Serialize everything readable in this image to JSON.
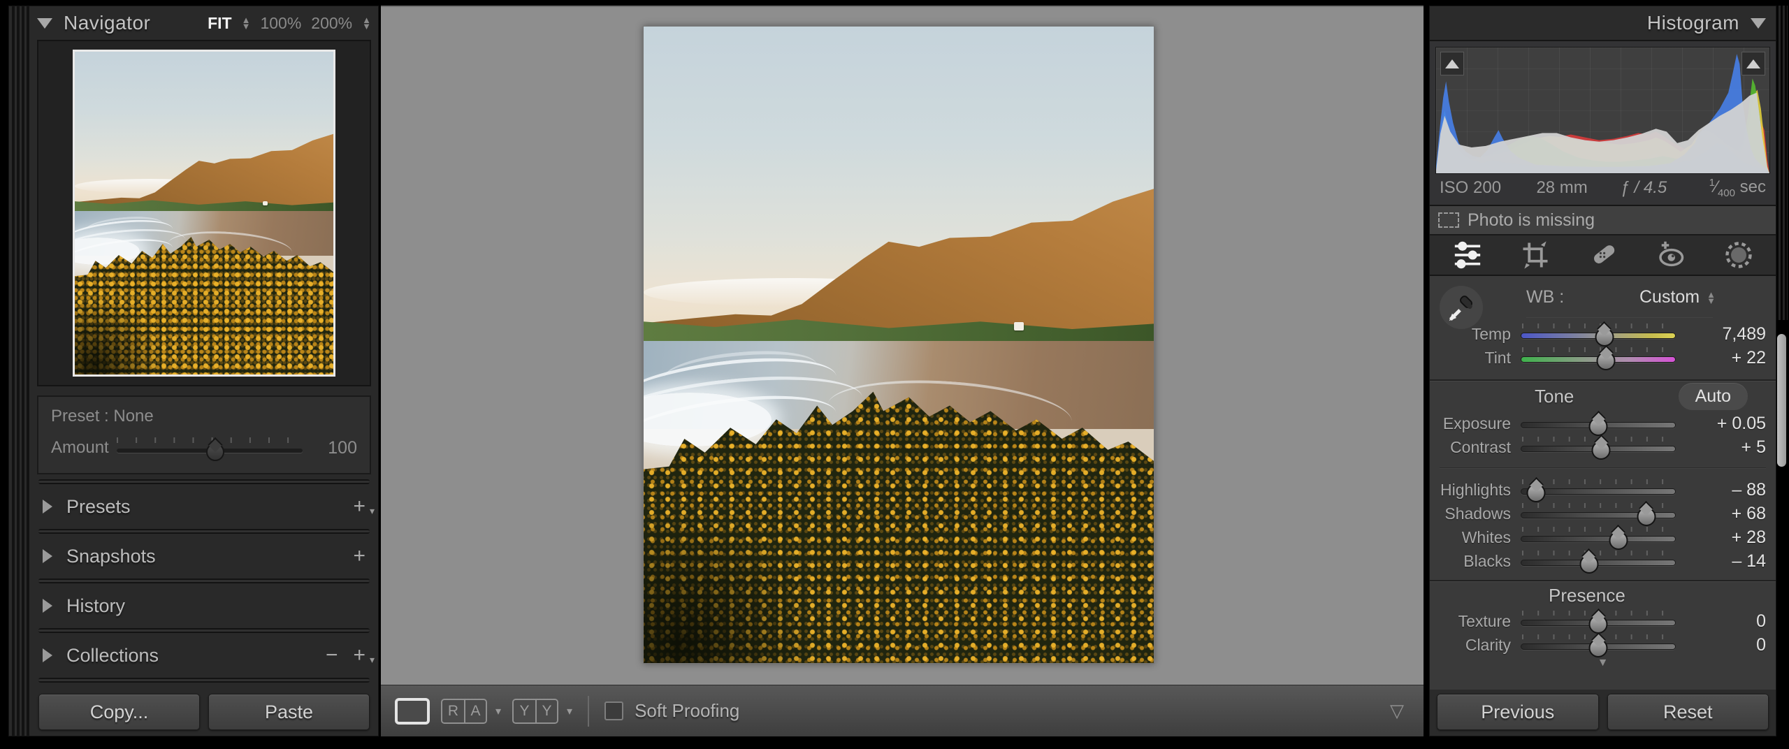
{
  "left_panel": {
    "navigator": {
      "title": "Navigator",
      "zoom_fit": "FIT",
      "zoom_100": "100%",
      "zoom_200": "200%"
    },
    "preset_box": {
      "preset_label": "Preset : None",
      "amount_label": "Amount",
      "amount_value": "100",
      "amount_thumb_pct": 53
    },
    "sections": [
      {
        "label": "Presets"
      },
      {
        "label": "Snapshots"
      },
      {
        "label": "History"
      },
      {
        "label": "Collections"
      }
    ],
    "copy_button": "Copy...",
    "paste_button": "Paste"
  },
  "toolbar": {
    "soft_proofing_label": "Soft Proofing",
    "view_letters": {
      "r": "R",
      "a": "A",
      "y1": "Y",
      "y2": "Y"
    },
    "icons": [
      "loupe-view",
      "compare-view",
      "before-after-view"
    ]
  },
  "right_panel": {
    "histogram": {
      "title": "Histogram",
      "exif": {
        "iso": "ISO 200",
        "focal_length": "28 mm",
        "aperture": "ƒ / 4.5",
        "shutter_numerator": "1",
        "shutter_denominator": "400",
        "shutter_unit": "sec"
      },
      "channels": [
        {
          "name": "red",
          "color": "#e23b3b",
          "opacity": 0.85,
          "points": [
            [
              0,
              3
            ],
            [
              30,
              8
            ],
            [
              60,
              14
            ],
            [
              90,
              20
            ],
            [
              120,
              30
            ],
            [
              150,
              42
            ],
            [
              170,
              50
            ],
            [
              190,
              54
            ],
            [
              210,
              50
            ],
            [
              230,
              46
            ],
            [
              250,
              48
            ],
            [
              270,
              52
            ],
            [
              285,
              56
            ],
            [
              300,
              54
            ],
            [
              310,
              58
            ],
            [
              320,
              52
            ],
            [
              335,
              42
            ],
            [
              350,
              34
            ],
            [
              365,
              42
            ],
            [
              375,
              50
            ],
            [
              385,
              52
            ],
            [
              395,
              46
            ],
            [
              405,
              38
            ],
            [
              415,
              30
            ],
            [
              425,
              24
            ],
            [
              435,
              20
            ],
            [
              445,
              28
            ],
            [
              452,
              46
            ],
            [
              458,
              72
            ],
            [
              463,
              60
            ],
            [
              467,
              20
            ]
          ]
        },
        {
          "name": "magenta",
          "color": "#d63bd0",
          "opacity": 0.8,
          "points": [
            [
              0,
              2
            ],
            [
              100,
              6
            ],
            [
              200,
              8
            ],
            [
              290,
              14
            ],
            [
              300,
              24
            ],
            [
              310,
              28
            ],
            [
              318,
              20
            ],
            [
              330,
              12
            ],
            [
              380,
              10
            ],
            [
              400,
              16
            ],
            [
              410,
              26
            ],
            [
              418,
              32
            ],
            [
              425,
              24
            ],
            [
              435,
              12
            ],
            [
              467,
              4
            ]
          ]
        },
        {
          "name": "yellow",
          "color": "#ead73c",
          "opacity": 0.85,
          "points": [
            [
              0,
              3
            ],
            [
              20,
              8
            ],
            [
              40,
              16
            ],
            [
              60,
              22
            ],
            [
              80,
              26
            ],
            [
              100,
              30
            ],
            [
              120,
              40
            ],
            [
              140,
              48
            ],
            [
              160,
              52
            ],
            [
              180,
              50
            ],
            [
              200,
              46
            ],
            [
              220,
              44
            ],
            [
              240,
              42
            ],
            [
              260,
              40
            ],
            [
              280,
              42
            ],
            [
              300,
              46
            ],
            [
              310,
              50
            ],
            [
              320,
              46
            ],
            [
              330,
              40
            ],
            [
              345,
              30
            ],
            [
              360,
              40
            ],
            [
              370,
              55
            ],
            [
              380,
              60
            ],
            [
              390,
              56
            ],
            [
              400,
              48
            ],
            [
              410,
              40
            ],
            [
              420,
              34
            ],
            [
              430,
              30
            ],
            [
              440,
              60
            ],
            [
              448,
              110
            ],
            [
              453,
              116
            ],
            [
              458,
              90
            ],
            [
              462,
              55
            ],
            [
              467,
              10
            ]
          ]
        },
        {
          "name": "green",
          "color": "#57c22f",
          "opacity": 0.85,
          "points": [
            [
              0,
              4
            ],
            [
              20,
              10
            ],
            [
              40,
              14
            ],
            [
              60,
              18
            ],
            [
              80,
              28
            ],
            [
              100,
              38
            ],
            [
              115,
              46
            ],
            [
              130,
              52
            ],
            [
              145,
              50
            ],
            [
              160,
              42
            ],
            [
              180,
              30
            ],
            [
              200,
              22
            ],
            [
              220,
              18
            ],
            [
              240,
              16
            ],
            [
              260,
              16
            ],
            [
              280,
              18
            ],
            [
              300,
              20
            ],
            [
              320,
              24
            ],
            [
              340,
              20
            ],
            [
              360,
              24
            ],
            [
              380,
              30
            ],
            [
              395,
              36
            ],
            [
              405,
              34
            ],
            [
              415,
              30
            ],
            [
              425,
              30
            ],
            [
              432,
              40
            ],
            [
              440,
              82
            ],
            [
              446,
              132
            ],
            [
              450,
              122
            ],
            [
              456,
              82
            ],
            [
              461,
              40
            ],
            [
              467,
              8
            ]
          ]
        },
        {
          "name": "cyan",
          "color": "#3fc6cf",
          "opacity": 0.8,
          "points": [
            [
              0,
              10
            ],
            [
              4,
              40
            ],
            [
              8,
              68
            ],
            [
              12,
              88
            ],
            [
              16,
              72
            ],
            [
              22,
              52
            ],
            [
              30,
              34
            ],
            [
              40,
              24
            ],
            [
              52,
              18
            ],
            [
              64,
              14
            ],
            [
              80,
              18
            ],
            [
              100,
              14
            ],
            [
              140,
              10
            ],
            [
              200,
              9
            ],
            [
              260,
              9
            ],
            [
              320,
              11
            ],
            [
              360,
              18
            ],
            [
              380,
              30
            ],
            [
              395,
              42
            ],
            [
              405,
              40
            ],
            [
              415,
              32
            ],
            [
              425,
              22
            ],
            [
              435,
              14
            ],
            [
              467,
              4
            ]
          ]
        },
        {
          "name": "blue",
          "color": "#477fe8",
          "opacity": 0.9,
          "points": [
            [
              0,
              10
            ],
            [
              6,
              70
            ],
            [
              10,
              105
            ],
            [
              14,
              128
            ],
            [
              18,
              100
            ],
            [
              24,
              70
            ],
            [
              32,
              42
            ],
            [
              42,
              30
            ],
            [
              52,
              24
            ],
            [
              62,
              22
            ],
            [
              72,
              32
            ],
            [
              82,
              50
            ],
            [
              88,
              60
            ],
            [
              94,
              48
            ],
            [
              104,
              32
            ],
            [
              116,
              22
            ],
            [
              140,
              12
            ],
            [
              180,
              10
            ],
            [
              220,
              9
            ],
            [
              260,
              9
            ],
            [
              300,
              10
            ],
            [
              330,
              14
            ],
            [
              350,
              26
            ],
            [
              365,
              42
            ],
            [
              370,
              55
            ],
            [
              385,
              70
            ],
            [
              400,
              90
            ],
            [
              412,
              112
            ],
            [
              418,
              138
            ],
            [
              424,
              166
            ],
            [
              428,
              152
            ],
            [
              432,
              100
            ],
            [
              438,
              60
            ],
            [
              444,
              34
            ],
            [
              450,
              20
            ],
            [
              458,
              12
            ],
            [
              467,
              6
            ]
          ]
        },
        {
          "name": "luminance",
          "color": "#d2d2d2",
          "opacity": 0.95,
          "points": [
            [
              0,
              4
            ],
            [
              6,
              55
            ],
            [
              12,
              80
            ],
            [
              20,
              58
            ],
            [
              32,
              40
            ],
            [
              50,
              36
            ],
            [
              70,
              38
            ],
            [
              90,
              44
            ],
            [
              110,
              48
            ],
            [
              130,
              52
            ],
            [
              150,
              56
            ],
            [
              170,
              56
            ],
            [
              190,
              50
            ],
            [
              210,
              46
            ],
            [
              230,
              44
            ],
            [
              250,
              46
            ],
            [
              270,
              50
            ],
            [
              290,
              55
            ],
            [
              310,
              62
            ],
            [
              325,
              58
            ],
            [
              340,
              42
            ],
            [
              355,
              46
            ],
            [
              370,
              60
            ],
            [
              385,
              70
            ],
            [
              400,
              80
            ],
            [
              415,
              88
            ],
            [
              430,
              98
            ],
            [
              442,
              108
            ],
            [
              452,
              112
            ],
            [
              460,
              50
            ],
            [
              467,
              8
            ]
          ]
        }
      ]
    },
    "missing_banner": "Photo is missing",
    "tools": [
      "edit-sliders",
      "crop-overlay",
      "healing-brush",
      "red-eye-correction",
      "masking"
    ],
    "basic": {
      "wb_label": "WB :",
      "wb_value": "Custom",
      "wb_rows": [
        {
          "label": "Temp",
          "value": "7,489",
          "thumb_pct": 54
        },
        {
          "label": "Tint",
          "value": "+ 22",
          "thumb_pct": 55
        }
      ],
      "tone_title": "Tone",
      "auto_button": "Auto",
      "tone_rows": [
        {
          "label": "Exposure",
          "value": "+ 0.05",
          "thumb_pct": 50
        },
        {
          "label": "Contrast",
          "value": "+ 5",
          "thumb_pct": 52
        }
      ],
      "tone_rows2": [
        {
          "label": "Highlights",
          "value": "– 88",
          "thumb_pct": 10
        },
        {
          "label": "Shadows",
          "value": "+ 68",
          "thumb_pct": 81
        },
        {
          "label": "Whites",
          "value": "+ 28",
          "thumb_pct": 63
        },
        {
          "label": "Blacks",
          "value": "– 14",
          "thumb_pct": 44
        }
      ],
      "presence_title": "Presence",
      "presence_rows": [
        {
          "label": "Texture",
          "value": "0",
          "thumb_pct": 50
        },
        {
          "label": "Clarity",
          "value": "0",
          "thumb_pct": 50
        }
      ]
    },
    "previous_button": "Previous",
    "reset_button": "Reset"
  },
  "colors": {
    "panel_bg": "#2b2b2b",
    "basic_bg": "#3a3a3a",
    "content_bg": "#8e8e8e",
    "hist_blue": "#477fe8",
    "hist_green": "#57c22f",
    "hist_red": "#e23b3b",
    "hist_yellow": "#ead73c",
    "hist_cyan": "#3fc6cf",
    "hist_magenta": "#d63bd0"
  }
}
